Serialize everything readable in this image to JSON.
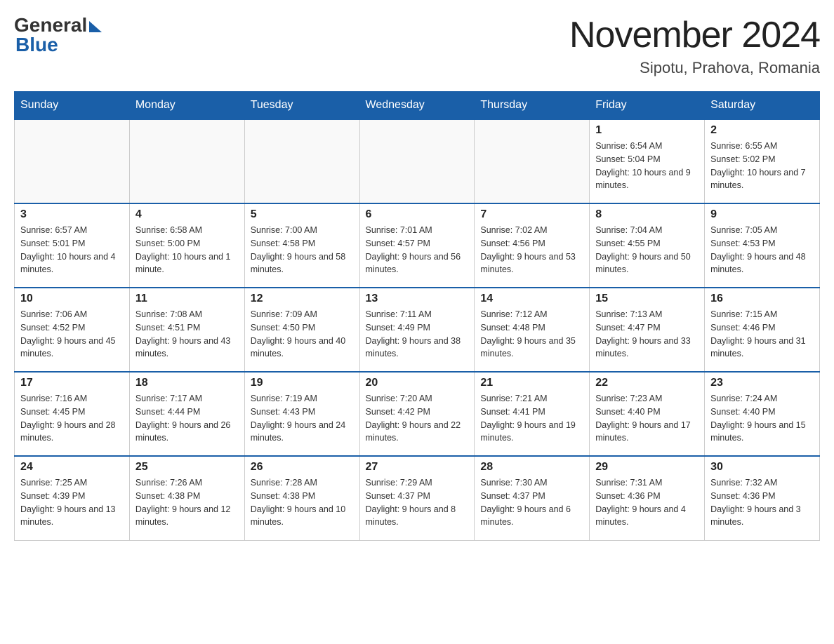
{
  "header": {
    "logo": {
      "general": "General",
      "blue": "Blue"
    },
    "month_title": "November 2024",
    "location": "Sipotu, Prahova, Romania"
  },
  "weekdays": [
    "Sunday",
    "Monday",
    "Tuesday",
    "Wednesday",
    "Thursday",
    "Friday",
    "Saturday"
  ],
  "weeks": [
    [
      {
        "day": "",
        "sunrise": "",
        "sunset": "",
        "daylight": ""
      },
      {
        "day": "",
        "sunrise": "",
        "sunset": "",
        "daylight": ""
      },
      {
        "day": "",
        "sunrise": "",
        "sunset": "",
        "daylight": ""
      },
      {
        "day": "",
        "sunrise": "",
        "sunset": "",
        "daylight": ""
      },
      {
        "day": "",
        "sunrise": "",
        "sunset": "",
        "daylight": ""
      },
      {
        "day": "1",
        "sunrise": "Sunrise: 6:54 AM",
        "sunset": "Sunset: 5:04 PM",
        "daylight": "Daylight: 10 hours and 9 minutes."
      },
      {
        "day": "2",
        "sunrise": "Sunrise: 6:55 AM",
        "sunset": "Sunset: 5:02 PM",
        "daylight": "Daylight: 10 hours and 7 minutes."
      }
    ],
    [
      {
        "day": "3",
        "sunrise": "Sunrise: 6:57 AM",
        "sunset": "Sunset: 5:01 PM",
        "daylight": "Daylight: 10 hours and 4 minutes."
      },
      {
        "day": "4",
        "sunrise": "Sunrise: 6:58 AM",
        "sunset": "Sunset: 5:00 PM",
        "daylight": "Daylight: 10 hours and 1 minute."
      },
      {
        "day": "5",
        "sunrise": "Sunrise: 7:00 AM",
        "sunset": "Sunset: 4:58 PM",
        "daylight": "Daylight: 9 hours and 58 minutes."
      },
      {
        "day": "6",
        "sunrise": "Sunrise: 7:01 AM",
        "sunset": "Sunset: 4:57 PM",
        "daylight": "Daylight: 9 hours and 56 minutes."
      },
      {
        "day": "7",
        "sunrise": "Sunrise: 7:02 AM",
        "sunset": "Sunset: 4:56 PM",
        "daylight": "Daylight: 9 hours and 53 minutes."
      },
      {
        "day": "8",
        "sunrise": "Sunrise: 7:04 AM",
        "sunset": "Sunset: 4:55 PM",
        "daylight": "Daylight: 9 hours and 50 minutes."
      },
      {
        "day": "9",
        "sunrise": "Sunrise: 7:05 AM",
        "sunset": "Sunset: 4:53 PM",
        "daylight": "Daylight: 9 hours and 48 minutes."
      }
    ],
    [
      {
        "day": "10",
        "sunrise": "Sunrise: 7:06 AM",
        "sunset": "Sunset: 4:52 PM",
        "daylight": "Daylight: 9 hours and 45 minutes."
      },
      {
        "day": "11",
        "sunrise": "Sunrise: 7:08 AM",
        "sunset": "Sunset: 4:51 PM",
        "daylight": "Daylight: 9 hours and 43 minutes."
      },
      {
        "day": "12",
        "sunrise": "Sunrise: 7:09 AM",
        "sunset": "Sunset: 4:50 PM",
        "daylight": "Daylight: 9 hours and 40 minutes."
      },
      {
        "day": "13",
        "sunrise": "Sunrise: 7:11 AM",
        "sunset": "Sunset: 4:49 PM",
        "daylight": "Daylight: 9 hours and 38 minutes."
      },
      {
        "day": "14",
        "sunrise": "Sunrise: 7:12 AM",
        "sunset": "Sunset: 4:48 PM",
        "daylight": "Daylight: 9 hours and 35 minutes."
      },
      {
        "day": "15",
        "sunrise": "Sunrise: 7:13 AM",
        "sunset": "Sunset: 4:47 PM",
        "daylight": "Daylight: 9 hours and 33 minutes."
      },
      {
        "day": "16",
        "sunrise": "Sunrise: 7:15 AM",
        "sunset": "Sunset: 4:46 PM",
        "daylight": "Daylight: 9 hours and 31 minutes."
      }
    ],
    [
      {
        "day": "17",
        "sunrise": "Sunrise: 7:16 AM",
        "sunset": "Sunset: 4:45 PM",
        "daylight": "Daylight: 9 hours and 28 minutes."
      },
      {
        "day": "18",
        "sunrise": "Sunrise: 7:17 AM",
        "sunset": "Sunset: 4:44 PM",
        "daylight": "Daylight: 9 hours and 26 minutes."
      },
      {
        "day": "19",
        "sunrise": "Sunrise: 7:19 AM",
        "sunset": "Sunset: 4:43 PM",
        "daylight": "Daylight: 9 hours and 24 minutes."
      },
      {
        "day": "20",
        "sunrise": "Sunrise: 7:20 AM",
        "sunset": "Sunset: 4:42 PM",
        "daylight": "Daylight: 9 hours and 22 minutes."
      },
      {
        "day": "21",
        "sunrise": "Sunrise: 7:21 AM",
        "sunset": "Sunset: 4:41 PM",
        "daylight": "Daylight: 9 hours and 19 minutes."
      },
      {
        "day": "22",
        "sunrise": "Sunrise: 7:23 AM",
        "sunset": "Sunset: 4:40 PM",
        "daylight": "Daylight: 9 hours and 17 minutes."
      },
      {
        "day": "23",
        "sunrise": "Sunrise: 7:24 AM",
        "sunset": "Sunset: 4:40 PM",
        "daylight": "Daylight: 9 hours and 15 minutes."
      }
    ],
    [
      {
        "day": "24",
        "sunrise": "Sunrise: 7:25 AM",
        "sunset": "Sunset: 4:39 PM",
        "daylight": "Daylight: 9 hours and 13 minutes."
      },
      {
        "day": "25",
        "sunrise": "Sunrise: 7:26 AM",
        "sunset": "Sunset: 4:38 PM",
        "daylight": "Daylight: 9 hours and 12 minutes."
      },
      {
        "day": "26",
        "sunrise": "Sunrise: 7:28 AM",
        "sunset": "Sunset: 4:38 PM",
        "daylight": "Daylight: 9 hours and 10 minutes."
      },
      {
        "day": "27",
        "sunrise": "Sunrise: 7:29 AM",
        "sunset": "Sunset: 4:37 PM",
        "daylight": "Daylight: 9 hours and 8 minutes."
      },
      {
        "day": "28",
        "sunrise": "Sunrise: 7:30 AM",
        "sunset": "Sunset: 4:37 PM",
        "daylight": "Daylight: 9 hours and 6 minutes."
      },
      {
        "day": "29",
        "sunrise": "Sunrise: 7:31 AM",
        "sunset": "Sunset: 4:36 PM",
        "daylight": "Daylight: 9 hours and 4 minutes."
      },
      {
        "day": "30",
        "sunrise": "Sunrise: 7:32 AM",
        "sunset": "Sunset: 4:36 PM",
        "daylight": "Daylight: 9 hours and 3 minutes."
      }
    ]
  ]
}
